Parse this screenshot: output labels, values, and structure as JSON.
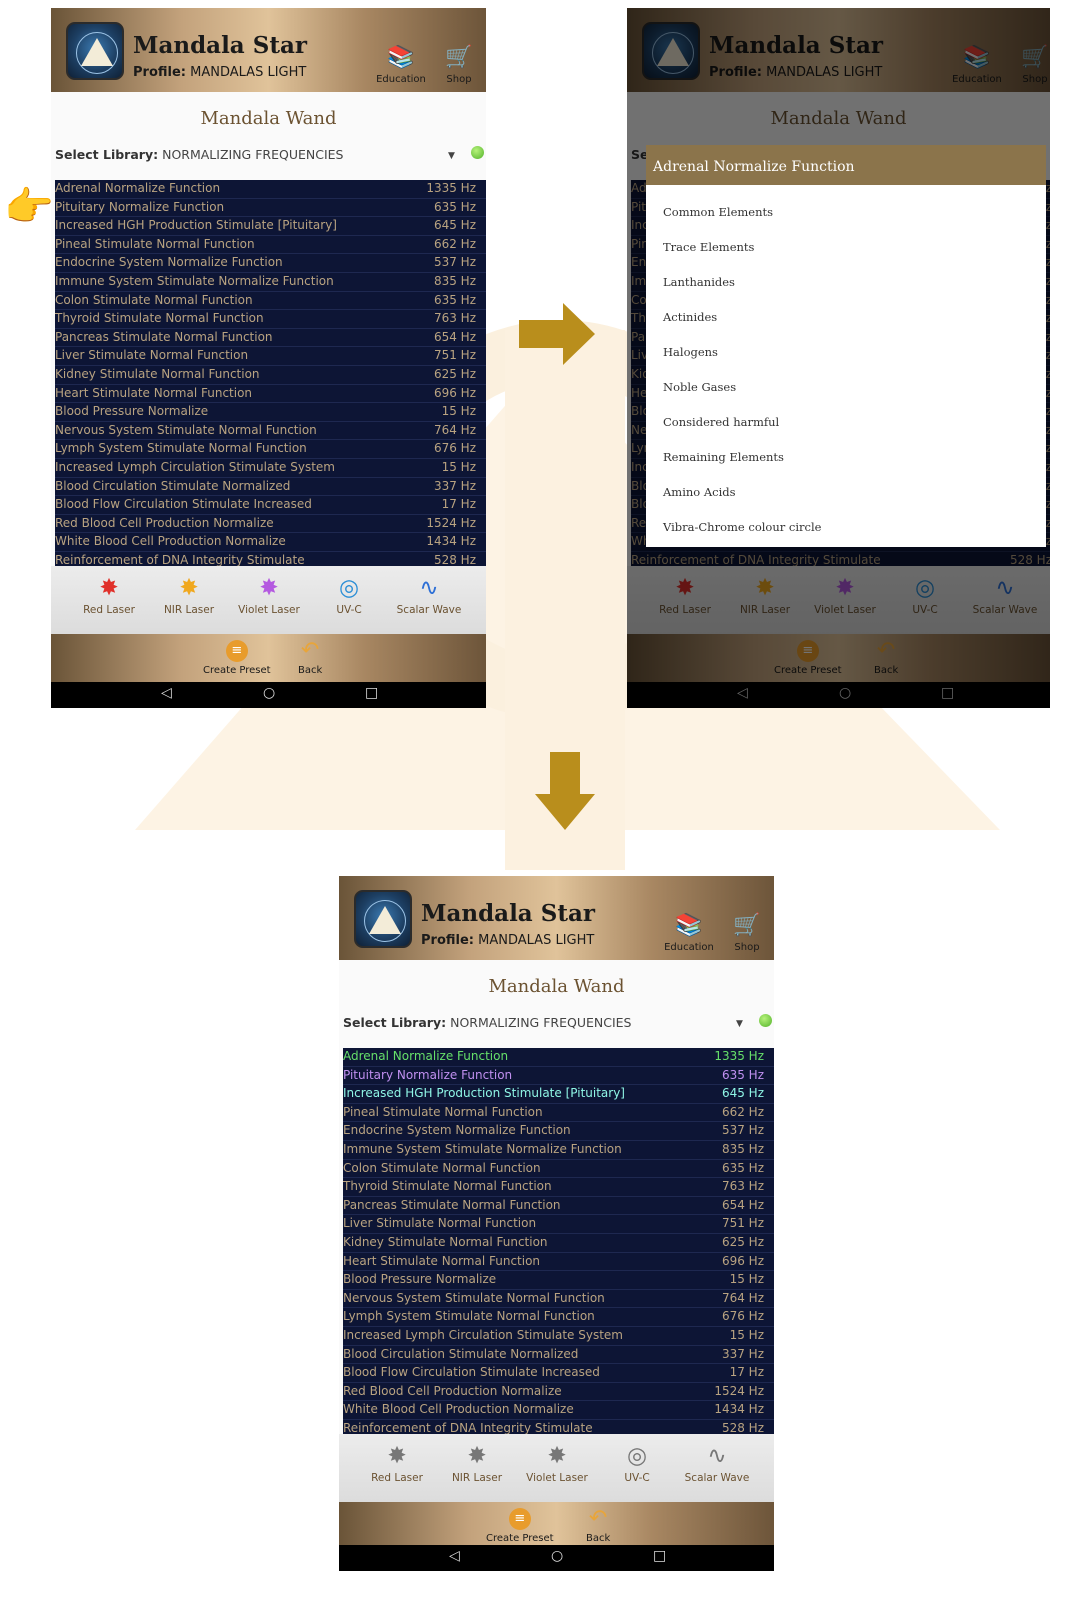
{
  "app": {
    "title": "Mandala Star",
    "profile_label": "Profile:",
    "profile_name": "MANDALAS LIGHT",
    "education_label": "Education",
    "shop_label": "Shop",
    "page_title": "Mandala Wand",
    "select_library_label": "Select Library:",
    "select_library_value": "NORMALIZING FREQUENCIES"
  },
  "frequencies": [
    {
      "name": "Adrenal Normalize Function",
      "hz": "1335 Hz"
    },
    {
      "name": "Pituitary Normalize Function",
      "hz": "635 Hz"
    },
    {
      "name": "Increased HGH Production Stimulate [Pituitary]",
      "hz": "645 Hz"
    },
    {
      "name": "Pineal Stimulate Normal Function",
      "hz": "662 Hz"
    },
    {
      "name": "Endocrine System Normalize Function",
      "hz": "537 Hz"
    },
    {
      "name": "Immune System Stimulate Normalize Function",
      "hz": "835 Hz"
    },
    {
      "name": "Colon Stimulate Normal Function",
      "hz": "635 Hz"
    },
    {
      "name": "Thyroid Stimulate Normal Function",
      "hz": "763 Hz"
    },
    {
      "name": "Pancreas Stimulate Normal Function",
      "hz": "654 Hz"
    },
    {
      "name": "Liver Stimulate Normal Function",
      "hz": "751 Hz"
    },
    {
      "name": "Kidney Stimulate Normal Function",
      "hz": "625 Hz"
    },
    {
      "name": "Heart Stimulate Normal Function",
      "hz": "696 Hz"
    },
    {
      "name": "Blood Pressure Normalize",
      "hz": "15 Hz"
    },
    {
      "name": "Nervous System Stimulate Normal Function",
      "hz": "764 Hz"
    },
    {
      "name": "Lymph System Stimulate Normal Function",
      "hz": "676 Hz"
    },
    {
      "name": "Increased Lymph Circulation Stimulate System",
      "hz": "15 Hz"
    },
    {
      "name": "Blood Circulation Stimulate Normalized",
      "hz": "337 Hz"
    },
    {
      "name": "Blood Flow Circulation Stimulate Increased",
      "hz": "17 Hz"
    },
    {
      "name": "Red Blood Cell Production Normalize",
      "hz": "1524 Hz"
    },
    {
      "name": "White Blood Cell Production Normalize",
      "hz": "1434 Hz"
    },
    {
      "name": "Reinforcement of DNA Integrity Stimulate",
      "hz": "528 Hz"
    }
  ],
  "tools": [
    "Red Laser",
    "NIR Laser",
    "Violet Laser",
    "UV-C",
    "Scalar Wave"
  ],
  "footer": {
    "create_preset": "Create Preset",
    "back": "Back"
  },
  "popup": {
    "title": "Adrenal Normalize Function",
    "items": [
      "Common Elements",
      "Trace Elements",
      "Lanthanides",
      "Actinides",
      "Halogens",
      "Noble Gases",
      "Considered harmful",
      "Remaining Elements",
      "Amino Acids",
      "Vibra-Chrome colour circle"
    ]
  },
  "colors": {
    "list_bg": "#0d1535",
    "list_text": "#b9a381",
    "header_gold": "#c3a27c",
    "arrow_gold": "#b98e1c",
    "selected_green": "#66e06a",
    "selected_purple": "#c090f0",
    "selected_cyan": "#8ff6e6"
  },
  "icons": {
    "red_laser": "red-burst",
    "nir_laser": "yellow-burst",
    "violet_laser": "violet-burst",
    "uvc": "uvc-badge",
    "scalar_wave": "wave",
    "education": "books",
    "shop": "cart",
    "pointer": "pointing-hand"
  }
}
